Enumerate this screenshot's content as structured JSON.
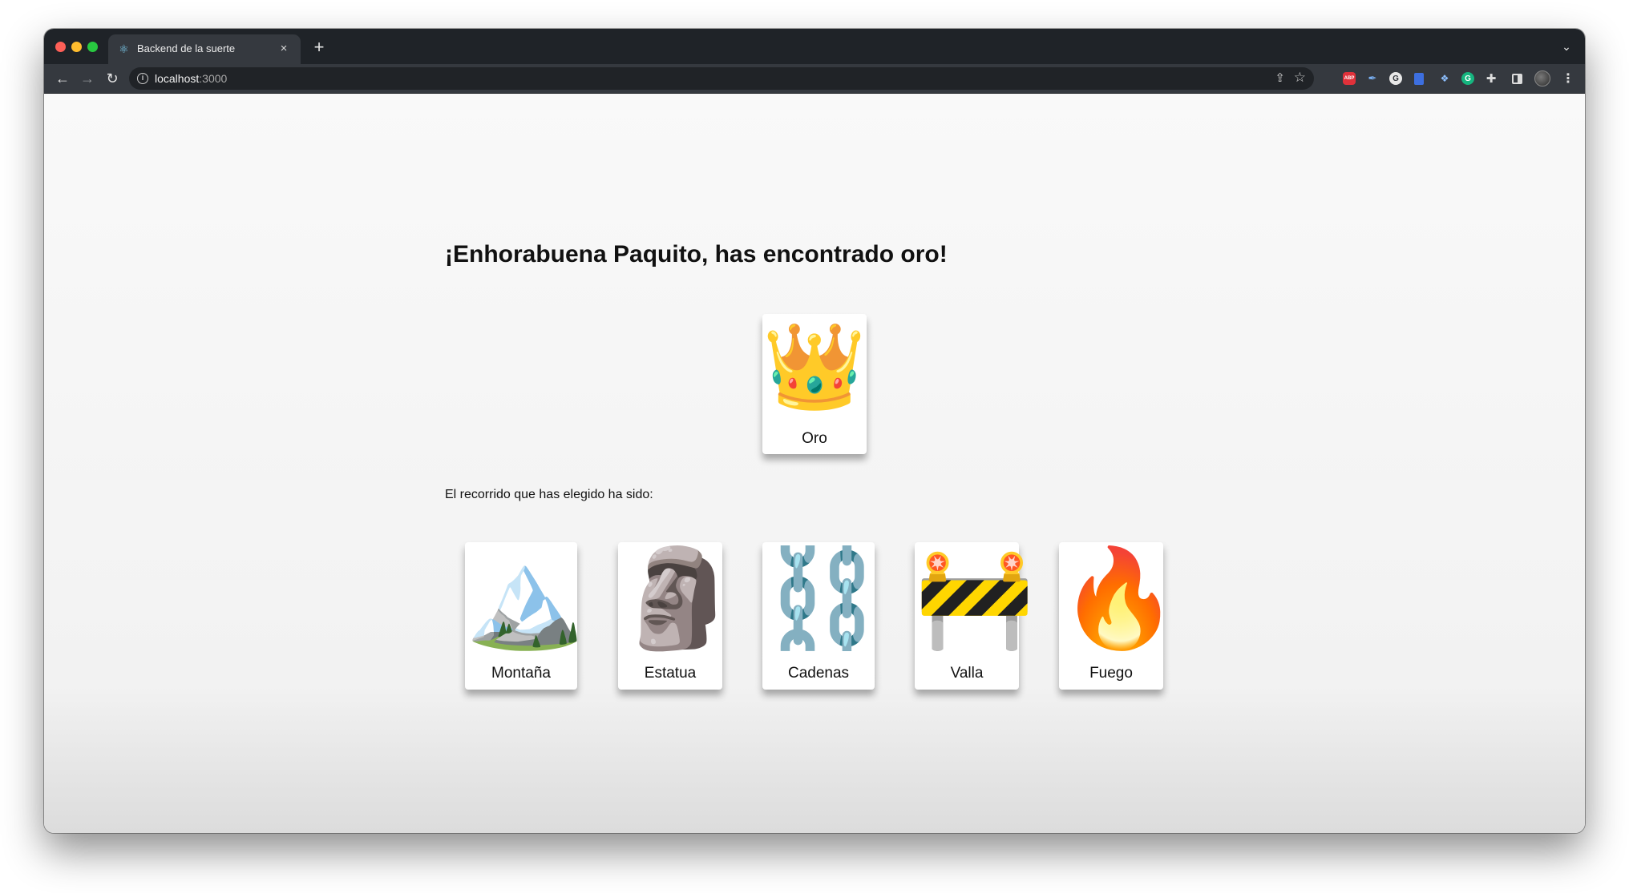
{
  "browser": {
    "tab_title": "Backend de la suerte",
    "tab_close": "×",
    "new_tab": "+",
    "tab_search": "⌄",
    "favicon": "⚛",
    "url_host": "localhost",
    "url_port": ":3000",
    "info_icon": "i",
    "back": "←",
    "forward": "→",
    "reload": "↻",
    "share": "⇪",
    "star": "☆",
    "extensions": {
      "abp": "ABP",
      "pen": "✒",
      "g": "G",
      "diamond": "❖",
      "grammarly": "G",
      "puzzle": "✚",
      "menu": "⋮"
    }
  },
  "page": {
    "title": "¡Enhorabuena Paquito, has encontrado oro!",
    "result": {
      "emoji": "👑",
      "label": "Oro"
    },
    "path_intro": "El recorrido que has elegido ha sido:",
    "path": [
      {
        "emoji": "🏔️",
        "label": "Montaña"
      },
      {
        "emoji": "🗿",
        "label": "Estatua"
      },
      {
        "emoji": "⛓️",
        "label": "Cadenas"
      },
      {
        "emoji": "🚧",
        "label": "Valla"
      },
      {
        "emoji": "🔥",
        "label": "Fuego"
      }
    ]
  },
  "colors": {
    "tabstrip": "#1f2328",
    "toolbar": "#35393f",
    "page_background": "#f9f9f9",
    "card_background": "#ffffff"
  }
}
